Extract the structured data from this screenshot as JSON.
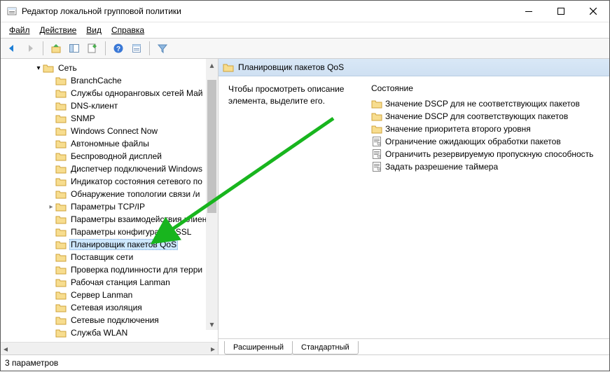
{
  "window": {
    "title": "Редактор локальной групповой политики"
  },
  "menu": {
    "file": "Файл",
    "action": "Действие",
    "view": "Вид",
    "help": "Справка"
  },
  "tree": {
    "root": "Сеть",
    "items": [
      "BranchCache",
      "Службы одноранговых сетей Май",
      "DNS-клиент",
      "SNMP",
      "Windows Connect Now",
      "Автономные файлы",
      "Беспроводной дисплей",
      "Диспетчер подключений Windows",
      "Индикатор состояния сетевого по",
      "Обнаружение топологии связи /и",
      "Параметры TCP/IP",
      "Параметры взаимодействия клиен",
      "Параметры конфигурации SSL",
      "Планировщик пакетов QoS",
      "Поставщик сети",
      "Проверка подлинности для терри",
      "Рабочая станция Lanman",
      "Сервер Lanman",
      "Сетевая изоляция",
      "Сетевые подключения",
      "Служба WLAN"
    ],
    "selected_index": 13,
    "expander_index": 10
  },
  "content": {
    "header": "Планировщик пакетов QoS",
    "description": "Чтобы просмотреть описание элемента, выделите его.",
    "list_header": "Состояние",
    "items": [
      {
        "type": "folder",
        "label": "Значение DSCP для не соответствующих пакетов"
      },
      {
        "type": "folder",
        "label": "Значение DSCP для соответствующих пакетов"
      },
      {
        "type": "folder",
        "label": "Значение приоритета второго уровня"
      },
      {
        "type": "setting",
        "label": "Ограничение ожидающих обработки пакетов"
      },
      {
        "type": "setting",
        "label": "Ограничить резервируемую пропускную способность"
      },
      {
        "type": "setting",
        "label": "Задать разрешение таймера"
      }
    ]
  },
  "tabs": {
    "extended": "Расширенный",
    "standard": "Стандартный"
  },
  "status": "3 параметров",
  "colors": {
    "header_gradient_top": "#d9e8f7",
    "selection": "#cde8ff",
    "arrow": "#18b51e"
  }
}
